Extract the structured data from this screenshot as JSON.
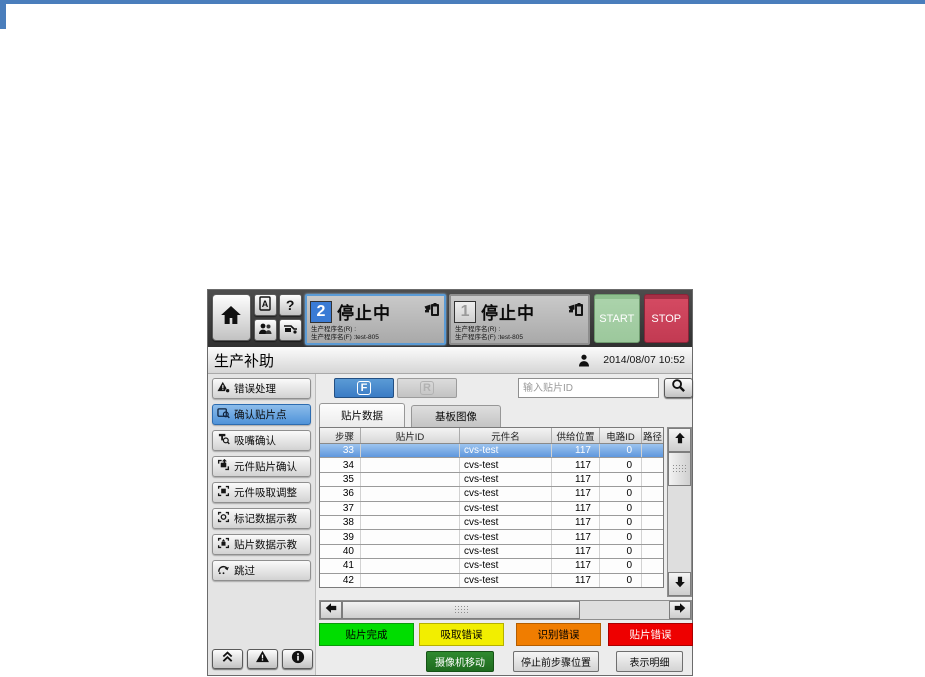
{
  "page": {
    "accent_color": "#4a7ebc"
  },
  "window": {
    "header": {
      "machines": [
        {
          "number": "2",
          "status": "停止中",
          "program_line1": "生产程序名(R) :",
          "program_line2": "生产程序名(F) :test-805",
          "selected": true
        },
        {
          "number": "1",
          "status": "停止中",
          "program_line1": "生产程序名(R) :",
          "program_line2": "生产程序名(F) :test-805",
          "selected": false
        }
      ],
      "start_label": "START",
      "stop_label": "STOP"
    },
    "titlebar": {
      "title": "生产补助",
      "datetime": "2014/08/07 10:52"
    },
    "sidebar": {
      "items": [
        {
          "label": "错误处理",
          "selected": false
        },
        {
          "label": "确认贴片点",
          "selected": true
        },
        {
          "label": "吸嘴确认",
          "selected": false
        },
        {
          "label": "元件贴片确认",
          "selected": false
        },
        {
          "label": "元件吸取调整",
          "selected": false
        },
        {
          "label": "标记数据示教",
          "selected": false
        },
        {
          "label": "贴片数据示教",
          "selected": false
        },
        {
          "label": "跳过",
          "selected": false
        }
      ]
    },
    "toolbar": {
      "front_label": "F",
      "rear_label": "R",
      "front_selected": true,
      "search_placeholder": "输入贴片ID"
    },
    "tabs": [
      {
        "label": "贴片数据",
        "selected": true
      },
      {
        "label": "基板图像",
        "selected": false
      }
    ],
    "table": {
      "columns": [
        "步骤",
        "贴片ID",
        "元件名",
        "供给位置",
        "电路ID",
        "路径"
      ],
      "rows": [
        {
          "step": "33",
          "chip_id": "",
          "part_name": "cvs-test",
          "feed_pos": "117",
          "circuit_id": "0",
          "path": "",
          "selected": true
        },
        {
          "step": "34",
          "chip_id": "",
          "part_name": "cvs-test",
          "feed_pos": "117",
          "circuit_id": "0",
          "path": "",
          "selected": false
        },
        {
          "step": "35",
          "chip_id": "",
          "part_name": "cvs-test",
          "feed_pos": "117",
          "circuit_id": "0",
          "path": "",
          "selected": false
        },
        {
          "step": "36",
          "chip_id": "",
          "part_name": "cvs-test",
          "feed_pos": "117",
          "circuit_id": "0",
          "path": "",
          "selected": false
        },
        {
          "step": "37",
          "chip_id": "",
          "part_name": "cvs-test",
          "feed_pos": "117",
          "circuit_id": "0",
          "path": "",
          "selected": false
        },
        {
          "step": "38",
          "chip_id": "",
          "part_name": "cvs-test",
          "feed_pos": "117",
          "circuit_id": "0",
          "path": "",
          "selected": false
        },
        {
          "step": "39",
          "chip_id": "",
          "part_name": "cvs-test",
          "feed_pos": "117",
          "circuit_id": "0",
          "path": "",
          "selected": false
        },
        {
          "step": "40",
          "chip_id": "",
          "part_name": "cvs-test",
          "feed_pos": "117",
          "circuit_id": "0",
          "path": "",
          "selected": false
        },
        {
          "step": "41",
          "chip_id": "",
          "part_name": "cvs-test",
          "feed_pos": "117",
          "circuit_id": "0",
          "path": "",
          "selected": false
        },
        {
          "step": "42",
          "chip_id": "",
          "part_name": "cvs-test",
          "feed_pos": "117",
          "circuit_id": "0",
          "path": "",
          "selected": false
        }
      ]
    },
    "legend": [
      {
        "label": "贴片完成",
        "color": "#00dd00",
        "border": "#0a9a0a",
        "text_color": "#000000"
      },
      {
        "label": "吸取错误",
        "color": "#f2ee00",
        "border": "#b5b000",
        "text_color": "#000000"
      },
      {
        "label": "识别错误",
        "color": "#f07d00",
        "border": "#b35d00",
        "text_color": "#000000"
      },
      {
        "label": "贴片错误",
        "color": "#ee0000",
        "border": "#a80000",
        "text_color": "#ffffff"
      }
    ],
    "actions": [
      {
        "label": "摄像机移动"
      },
      {
        "label": "停止前步骤位置"
      },
      {
        "label": "表示明细"
      }
    ]
  }
}
